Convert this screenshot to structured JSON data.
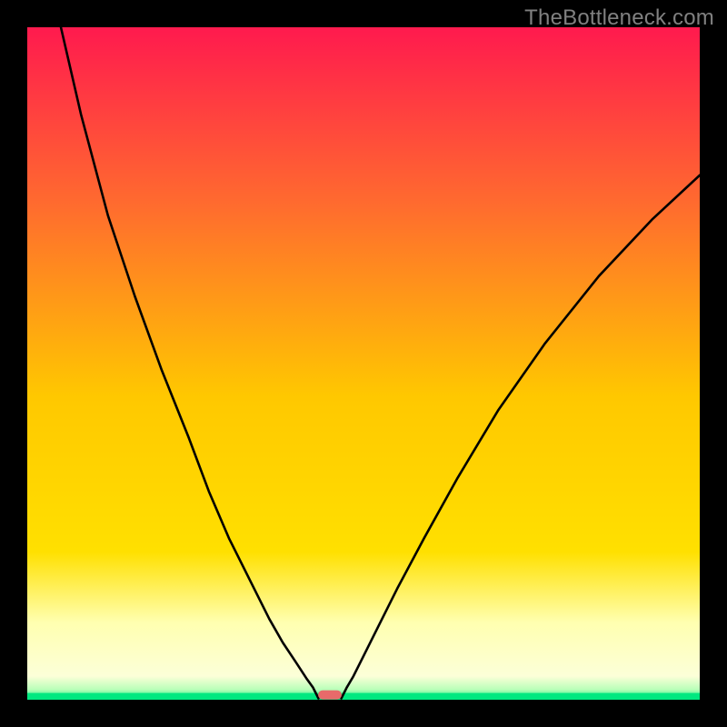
{
  "watermark": "TheBottleneck.com",
  "chart_data": {
    "type": "line",
    "title": "",
    "xlabel": "",
    "ylabel": "",
    "xlim": [
      0,
      100
    ],
    "ylim": [
      0,
      100
    ],
    "background_gradient": {
      "top": "#ff1a4e",
      "mid": "#ffe000",
      "lower": "#ffffb0",
      "bottom": "#00e880"
    },
    "series": [
      {
        "name": "left-curve",
        "x": [
          5,
          8,
          12,
          16,
          20,
          24,
          27,
          30,
          33,
          36,
          38,
          40,
          41.5,
          42.5,
          43,
          43.3
        ],
        "values": [
          100,
          87,
          72,
          60,
          49,
          39,
          31,
          24,
          18,
          12,
          8.5,
          5.5,
          3.2,
          1.8,
          0.8,
          0.2
        ]
      },
      {
        "name": "right-curve",
        "x": [
          46.7,
          47,
          47.5,
          48.5,
          50,
          52,
          55,
          59,
          64,
          70,
          77,
          85,
          93,
          100
        ],
        "values": [
          0.2,
          0.8,
          1.8,
          3.5,
          6.5,
          10.5,
          16.5,
          24,
          33,
          43,
          53,
          63,
          71.5,
          78
        ]
      }
    ],
    "marker": {
      "name": "bottleneck-marker",
      "x": 45,
      "width_fraction": 0.035,
      "color": "#e86a6a"
    },
    "green_band_height_fraction": 0.01,
    "pale_band_height_fraction": 0.09
  }
}
